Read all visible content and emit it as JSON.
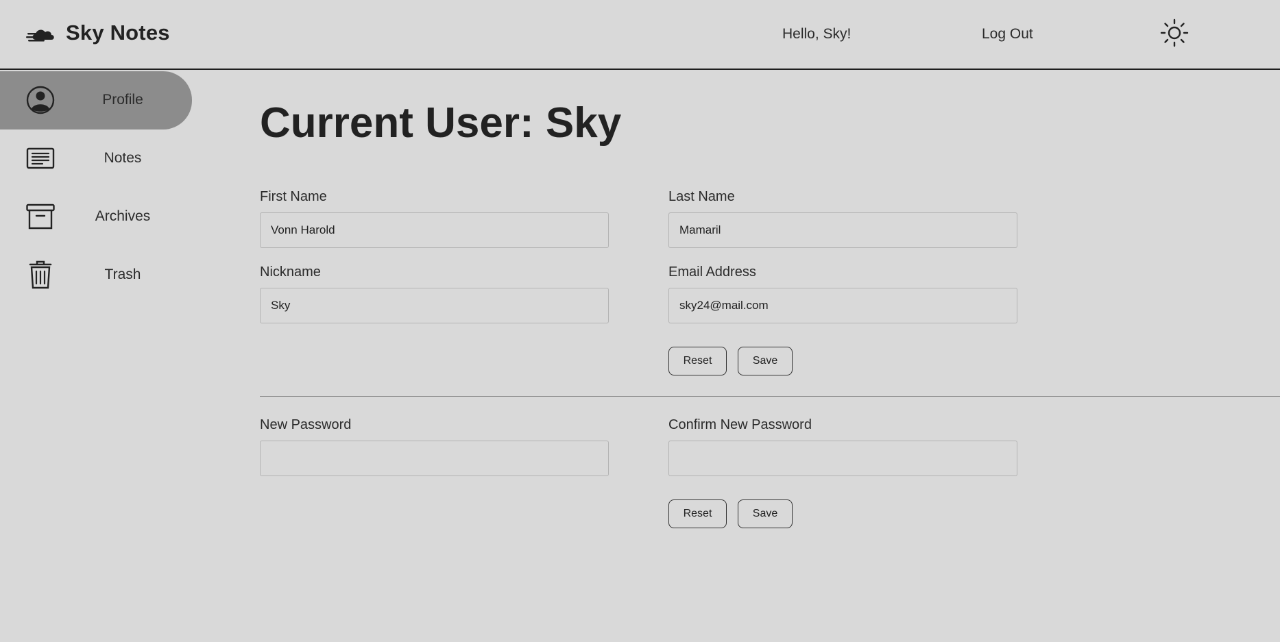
{
  "header": {
    "app_name": "Sky Notes",
    "logo_icon": "cloud-logo-icon",
    "greeting": "Hello, Sky!",
    "logout_label": "Log Out",
    "theme_icon": "sun-icon"
  },
  "sidebar": {
    "items": [
      {
        "label": "Profile",
        "icon": "user-circle-icon",
        "active": true
      },
      {
        "label": "Notes",
        "icon": "note-lines-icon",
        "active": false
      },
      {
        "label": "Archives",
        "icon": "archive-box-icon",
        "active": false
      },
      {
        "label": "Trash",
        "icon": "trash-can-icon",
        "active": false
      }
    ]
  },
  "profile": {
    "title": "Current User: Sky",
    "first_name": {
      "label": "First Name",
      "value": "Vonn Harold"
    },
    "last_name": {
      "label": "Last Name",
      "value": "Mamaril"
    },
    "nickname": {
      "label": "Nickname",
      "value": "Sky"
    },
    "email": {
      "label": "Email Address",
      "value": "sky24@mail.com"
    },
    "reset_label": "Reset",
    "save_label": "Save"
  },
  "password": {
    "new_password": {
      "label": "New Password",
      "value": ""
    },
    "confirm_password": {
      "label": "Confirm New Password",
      "value": ""
    },
    "reset_label": "Reset",
    "save_label": "Save"
  },
  "colors": {
    "background": "#d9d9d9",
    "active_nav": "#8c8c8c",
    "text": "#222222"
  }
}
